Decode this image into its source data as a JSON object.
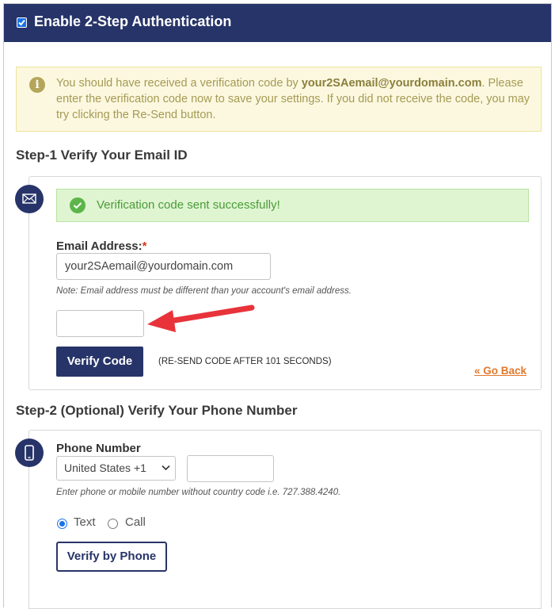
{
  "header": {
    "title": "Enable 2-Step Authentication",
    "checkbox_checked": true
  },
  "alert": {
    "icon": "info-icon",
    "text_before": "You should have received a verification code by ",
    "email": "your2SAemail@yourdomain.com",
    "text_after": ". Please enter the verification code now to save your settings. If you did not receive the code, you may try clicking the Re-Send button."
  },
  "step1": {
    "title": "Step-1 Verify Your Email ID",
    "icon": "envelope-icon",
    "success_message": "Verification code sent successfully!",
    "email_label": "Email Address:",
    "required_mark": "*",
    "email_value": "your2SAemail@yourdomain.com",
    "email_note": "Note: Email address must be different than your account's email address.",
    "code_value": "",
    "verify_button": "Verify Code",
    "resend_text": "(RE-SEND CODE AFTER 101 SECONDS)",
    "go_back": "« Go Back"
  },
  "step2": {
    "title": "Step-2 (Optional) Verify Your Phone Number",
    "icon": "mobile-phone-icon",
    "phone_label": "Phone Number",
    "country_selected": "United States +1",
    "phone_value": "",
    "phone_note": "Enter phone or mobile number without country code i.e. 727.388.4240.",
    "method_text": "Text",
    "method_call": "Call",
    "method_selected": "Text",
    "verify_button": "Verify by Phone"
  },
  "colors": {
    "brand_navy": "#273469",
    "alert_bg": "#fcf8e0",
    "success_bg": "#dff5d1",
    "link_orange": "#e1782c",
    "annotation_red": "#e8333a"
  }
}
